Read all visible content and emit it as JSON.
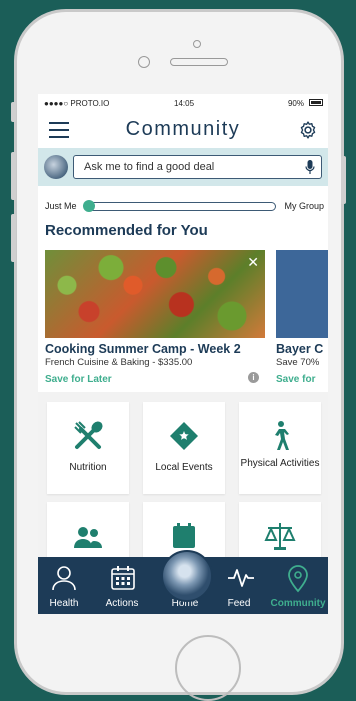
{
  "status": {
    "carrier": "●●●●○ PROTO.IO",
    "time": "14:05",
    "battery": "90%"
  },
  "header": {
    "title": "Community",
    "menu_icon": "hamburger-icon",
    "settings_icon": "gear-icon"
  },
  "search": {
    "placeholder": "Ask me to find a good deal",
    "mic_icon": "microphone-icon"
  },
  "slider": {
    "left_label": "Just Me",
    "right_label": "My Group",
    "value": 0
  },
  "recommended": {
    "title": "Recommended for You",
    "cards": [
      {
        "name": "Cooking Summer Camp - Week 2",
        "subtitle": "French Cuisine & Baking - $335.00",
        "action": "Save for Later",
        "close": "✕"
      },
      {
        "name": "Bayer C",
        "subtitle": "Save 70%",
        "action": "Save for"
      }
    ]
  },
  "tiles": [
    {
      "label": "Nutrition",
      "icon": "fork-spoon-icon"
    },
    {
      "label": "Local Events",
      "icon": "ticket-star-icon"
    },
    {
      "label": "Physical Activities",
      "icon": "walking-person-icon"
    },
    {
      "label": "",
      "icon": "group-icon"
    },
    {
      "label": "",
      "icon": "calendar-icon"
    },
    {
      "label": "",
      "icon": "scales-icon"
    }
  ],
  "tabs": [
    {
      "label": "Health",
      "icon": "person-icon"
    },
    {
      "label": "Actions",
      "icon": "calendar-icon"
    },
    {
      "label": "Home",
      "icon": "home-avatar"
    },
    {
      "label": "Feed",
      "icon": "activity-icon"
    },
    {
      "label": "Community",
      "icon": "location-pin-icon",
      "active": true
    }
  ],
  "colors": {
    "navy": "#1d3b57",
    "green": "#3fae8e",
    "teal_bg": "#1b5e58",
    "search_bg": "#d2e7ea"
  }
}
